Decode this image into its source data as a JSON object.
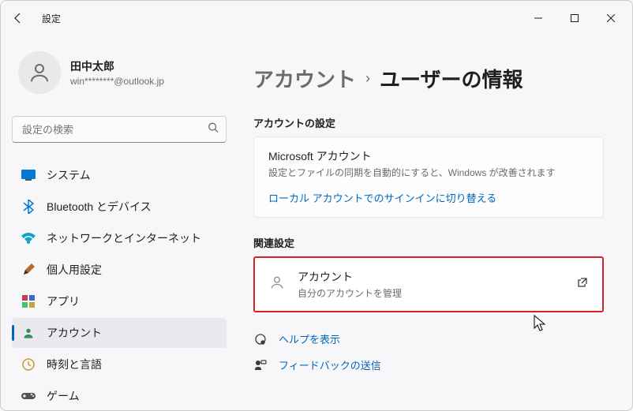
{
  "window": {
    "title": "設定"
  },
  "user": {
    "name": "田中太郎",
    "email": "win********@outlook.jp"
  },
  "search": {
    "placeholder": "設定の検索"
  },
  "sidebar": {
    "items": [
      {
        "label": "システム"
      },
      {
        "label": "Bluetooth とデバイス"
      },
      {
        "label": "ネットワークとインターネット"
      },
      {
        "label": "個人用設定"
      },
      {
        "label": "アプリ"
      },
      {
        "label": "アカウント"
      },
      {
        "label": "時刻と言語"
      },
      {
        "label": "ゲーム"
      }
    ]
  },
  "breadcrumb": {
    "parent": "アカウント",
    "current": "ユーザーの情報"
  },
  "account_settings": {
    "section_label": "アカウントの設定",
    "title": "Microsoft アカウント",
    "subtitle": "設定とファイルの同期を自動的にすると、Windows が改善されます",
    "link": "ローカル アカウントでのサインインに切り替える"
  },
  "related": {
    "section_label": "関連設定",
    "title": "アカウント",
    "subtitle": "自分のアカウントを管理"
  },
  "help": {
    "show": "ヘルプを表示",
    "feedback": "フィードバックの送信"
  }
}
